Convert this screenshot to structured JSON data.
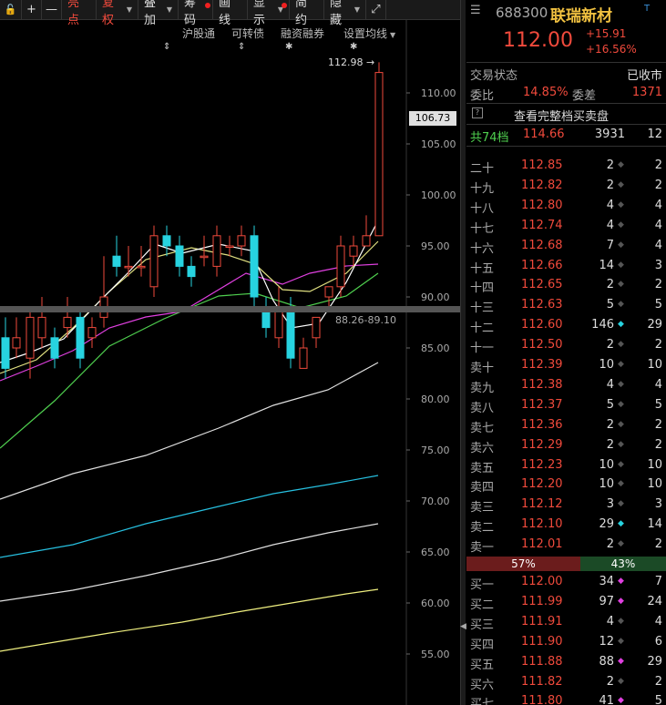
{
  "toolbar": {
    "items": [
      {
        "label": "",
        "icon": "lock-icon"
      },
      {
        "label": "+",
        "icon": "plus-icon"
      },
      {
        "label": "—",
        "icon": "minus-icon"
      },
      {
        "label": "亮点",
        "active": true
      },
      {
        "label": "复权",
        "active": true,
        "caret": true
      },
      {
        "label": "叠加",
        "caret": true
      },
      {
        "label": "筹码",
        "dot": true
      },
      {
        "label": "画线"
      },
      {
        "label": "显示",
        "caret": true,
        "dot": true
      },
      {
        "label": "简约"
      },
      {
        "label": "隐藏",
        "caret": true
      },
      {
        "label": "",
        "icon": "fullscreen-icon"
      }
    ]
  },
  "subheader": {
    "hgt": "沪股通",
    "convertible": "可转债",
    "margin": "融资融券",
    "ma_settings": "设置均线"
  },
  "chart": {
    "high_label": "112.98",
    "current_tag": "106.73",
    "hist_label": "88.26-89.10",
    "y_ticks": [
      "110.00",
      "105.00",
      "100.00",
      "95.00",
      "90.00",
      "85.00",
      "80.00",
      "75.00",
      "70.00",
      "65.00",
      "60.00",
      "55.00"
    ]
  },
  "quote": {
    "code": "688300",
    "name": "联瑞新材",
    "t_mark": "T",
    "price": "112.00",
    "change": "+15.91",
    "change_pct": "+16.56%",
    "trade_status_label": "交易状态",
    "trade_status": "已收市",
    "wb_label": "委比",
    "wb_value": "14.85%",
    "wc_label": "委差",
    "wc_value": "1371",
    "full_book": "查看完整档买卖盘",
    "total_label": "共74档",
    "total_price": "114.66",
    "total_vol": "3931",
    "total_count": "12"
  },
  "asks": [
    {
      "label": "二十",
      "price": "112.85",
      "vol": "2",
      "cnt": "2",
      "diamond": false
    },
    {
      "label": "十九",
      "price": "112.82",
      "vol": "2",
      "cnt": "2",
      "diamond": false
    },
    {
      "label": "十八",
      "price": "112.80",
      "vol": "4",
      "cnt": "4",
      "diamond": false
    },
    {
      "label": "十七",
      "price": "112.74",
      "vol": "4",
      "cnt": "4",
      "diamond": false
    },
    {
      "label": "十六",
      "price": "112.68",
      "vol": "7",
      "cnt": "4",
      "diamond": false
    },
    {
      "label": "十五",
      "price": "112.66",
      "vol": "14",
      "cnt": "3",
      "diamond": false
    },
    {
      "label": "十四",
      "price": "112.65",
      "vol": "2",
      "cnt": "2",
      "diamond": false
    },
    {
      "label": "十三",
      "price": "112.63",
      "vol": "5",
      "cnt": "5",
      "diamond": false
    },
    {
      "label": "十二",
      "price": "112.60",
      "vol": "146",
      "cnt": "29",
      "diamond": true
    },
    {
      "label": "十一",
      "price": "112.50",
      "vol": "2",
      "cnt": "2",
      "diamond": false
    },
    {
      "label": "卖十",
      "price": "112.39",
      "vol": "10",
      "cnt": "10",
      "diamond": false
    },
    {
      "label": "卖九",
      "price": "112.38",
      "vol": "4",
      "cnt": "4",
      "diamond": false
    },
    {
      "label": "卖八",
      "price": "112.37",
      "vol": "5",
      "cnt": "5",
      "diamond": false
    },
    {
      "label": "卖七",
      "price": "112.36",
      "vol": "2",
      "cnt": "2",
      "diamond": false
    },
    {
      "label": "卖六",
      "price": "112.29",
      "vol": "2",
      "cnt": "2",
      "diamond": false
    },
    {
      "label": "卖五",
      "price": "112.23",
      "vol": "10",
      "cnt": "10",
      "diamond": false
    },
    {
      "label": "卖四",
      "price": "112.20",
      "vol": "10",
      "cnt": "10",
      "diamond": false
    },
    {
      "label": "卖三",
      "price": "112.12",
      "vol": "3",
      "cnt": "3",
      "diamond": false
    },
    {
      "label": "卖二",
      "price": "112.10",
      "vol": "29",
      "cnt": "14",
      "diamond": true
    },
    {
      "label": "卖一",
      "price": "112.01",
      "vol": "2",
      "cnt": "2",
      "diamond": false
    }
  ],
  "ratio": {
    "left": "57%",
    "right": "43%",
    "left_value": 57
  },
  "bids": [
    {
      "label": "买一",
      "price": "112.00",
      "vol": "34",
      "cnt": "7",
      "diamond": true
    },
    {
      "label": "买二",
      "price": "111.99",
      "vol": "97",
      "cnt": "24",
      "diamond": true
    },
    {
      "label": "买三",
      "price": "111.91",
      "vol": "4",
      "cnt": "4",
      "diamond": false
    },
    {
      "label": "买四",
      "price": "111.90",
      "vol": "12",
      "cnt": "6",
      "diamond": false
    },
    {
      "label": "买五",
      "price": "111.88",
      "vol": "88",
      "cnt": "29",
      "diamond": true
    },
    {
      "label": "买六",
      "price": "111.82",
      "vol": "2",
      "cnt": "2",
      "diamond": false
    },
    {
      "label": "买七",
      "price": "111.80",
      "vol": "41",
      "cnt": "5",
      "diamond": true
    }
  ],
  "colors": {
    "up": "#f04a3c",
    "down": "#27d3e0",
    "bg": "#000000",
    "accent": "#f0c040"
  }
}
